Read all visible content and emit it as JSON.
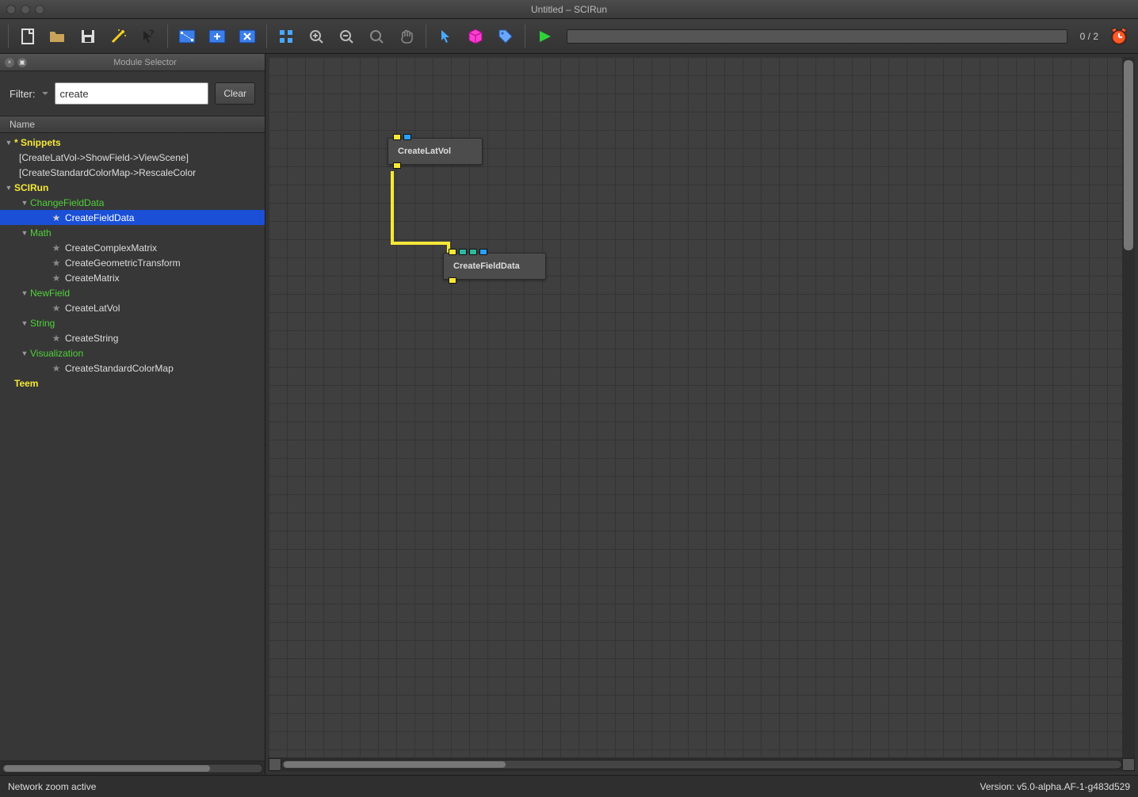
{
  "title": "Untitled – SCIRun",
  "toolbar": {
    "progress_text": "0 / 2"
  },
  "sidebar": {
    "panel_title": "Module Selector",
    "filter_label": "Filter:",
    "filter_value": "create",
    "clear_label": "Clear",
    "column_header": "Name",
    "tree": {
      "snippets_label": "* Snippets",
      "snippet1": "[CreateLatVol->ShowField->ViewScene]",
      "snippet2": "[CreateStandardColorMap->RescaleColor",
      "scirun_label": "SCIRun",
      "changefielddata": "ChangeFieldData",
      "createfielddata": "CreateFieldData",
      "math": "Math",
      "createcomplexmatrix": "CreateComplexMatrix",
      "creategeometrictransform": "CreateGeometricTransform",
      "creatematrix": "CreateMatrix",
      "newfield": "NewField",
      "createlatvol": "CreateLatVol",
      "string": "String",
      "createstring": "CreateString",
      "visualization": "Visualization",
      "createstandardcolormap": "CreateStandardColorMap",
      "teem": "Teem"
    }
  },
  "canvas": {
    "module1": "CreateLatVol",
    "module2": "CreateFieldData"
  },
  "status": {
    "left": "Network zoom active",
    "right": "Version: v5.0-alpha.AF-1-g483d529"
  }
}
